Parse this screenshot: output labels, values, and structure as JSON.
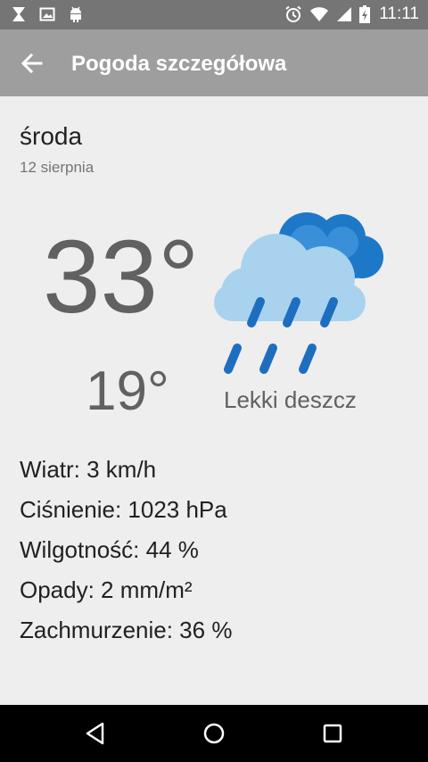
{
  "status_bar": {
    "time": "11:11",
    "left_icons": [
      "hourglass-icon",
      "image-icon",
      "android-icon"
    ],
    "right_icons": [
      "alarm-icon",
      "wifi-icon",
      "signal-icon",
      "battery-icon"
    ]
  },
  "app_bar": {
    "title": "Pogoda szczegółowa",
    "back_icon": "arrow-back-icon"
  },
  "day": {
    "name": "środa",
    "date": "12 sierpnia"
  },
  "forecast": {
    "temp_high": "33°",
    "temp_low": "19°",
    "description": "Lekki deszcz",
    "icon": "light-rain-icon"
  },
  "details": [
    "Wiatr: 3 km/h",
    "Ciśnienie: 1023 hPa",
    "Wilgotność: 44 %",
    "Opady: 2 mm/m²",
    "Zachmurzenie: 36 %"
  ],
  "nav_bar": {
    "icons": [
      "nav-back-icon",
      "nav-home-icon",
      "nav-recents-icon"
    ]
  },
  "colors": {
    "status_bar": "#757575",
    "app_bar": "#9e9e9e",
    "background": "#eeeeee",
    "cloud_dark": "#1e78c8",
    "cloud_light": "#a9d2ee",
    "rain": "#1e6ec0"
  }
}
